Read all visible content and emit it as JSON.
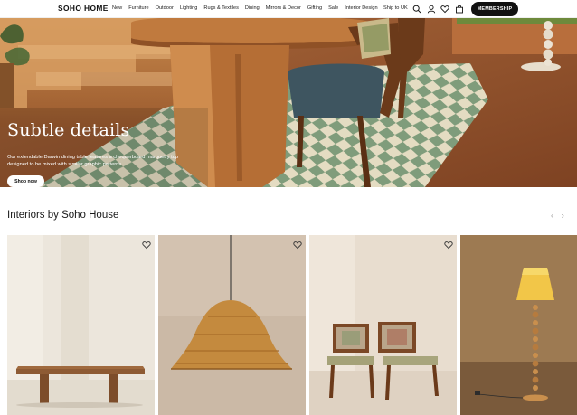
{
  "header": {
    "logo": "SOHO HOME",
    "nav": [
      "New",
      "Furniture",
      "Outdoor",
      "Lighting",
      "Rugs & Textiles",
      "Dining",
      "Mirrors & Decor",
      "Gifting",
      "Sale",
      "Interior Design"
    ],
    "ship_to": "Ship to UK",
    "membership": "MEMBERSHIP",
    "icons": [
      "search-icon",
      "account-icon",
      "heart-icon",
      "bag-icon"
    ]
  },
  "hero": {
    "title": "Subtle details",
    "description": "Our extendable Darwin dining table features a chequerboard marquetry top designed to be mixed with similar graphic patterns.",
    "cta": "Shop now"
  },
  "section": {
    "title": "Interiors by Soho House",
    "prev_arrow": "‹",
    "next_arrow": "›"
  },
  "cards": [
    {
      "name": "bench",
      "wishlist_icon": "heart-icon"
    },
    {
      "name": "rattan-pendant",
      "wishlist_icon": "heart-icon"
    },
    {
      "name": "dining-chairs",
      "wishlist_icon": "heart-icon"
    },
    {
      "name": "floor-lamp",
      "wishlist_icon": "heart-icon"
    }
  ],
  "colors": {
    "primary": "#111111",
    "background": "#ffffff",
    "hero_floor": "#9a5a2e",
    "rug_green": "#7c9a78",
    "rug_cream": "#e6dfc6"
  }
}
